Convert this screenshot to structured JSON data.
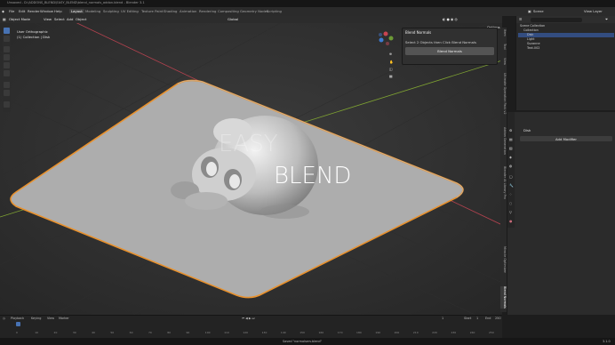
{
  "titlebar": {
    "text": "Unsaved - D:\\ADDONS_BLEND\\EASY_BLEND\\blend_normals_addon.blend - Blender 3.1"
  },
  "menubar": {
    "items": [
      "File",
      "Edit",
      "Render",
      "Window",
      "Help"
    ],
    "workspaces": [
      "Layout",
      "Modeling",
      "Sculpting",
      "UV Editing",
      "Texture Paint",
      "Shading",
      "Animation",
      "Rendering",
      "Compositing",
      "Geometry Nodes",
      "Scripting"
    ],
    "active_workspace": "Layout",
    "scene": "Scene",
    "view_layer": "View Layer"
  },
  "viewport_header": {
    "mode": "Object Mode",
    "menus": [
      "View",
      "Select",
      "Add",
      "Object"
    ],
    "transform": "Global",
    "options": "Options"
  },
  "overlay": {
    "view_name": "User Orthographic",
    "collection": "(1) Collection | Disk"
  },
  "scene_text": {
    "word1": "EASY",
    "word2": "BLEND"
  },
  "panel": {
    "title": "Blend Normals",
    "instruction": "Select 2 Objects then Click Blend Normals",
    "button": "Blend Normals"
  },
  "ntabs": [
    "Item",
    "Tool",
    "View",
    "Ultimate Operation Pack v2",
    "Addon Generation",
    "Blender AI Library Pro",
    "Miracle Optimizer",
    "Blend Normals"
  ],
  "outliner": {
    "search_placeholder": "",
    "items": [
      {
        "label": "Scene Collection",
        "indent": 0,
        "selected": false
      },
      {
        "label": "Collection",
        "indent": 1,
        "selected": false
      },
      {
        "label": "Disk",
        "indent": 2,
        "selected": true
      },
      {
        "label": "Light",
        "indent": 2,
        "selected": false
      },
      {
        "label": "Suzanne",
        "indent": 2,
        "selected": false
      },
      {
        "label": "Text.002",
        "indent": 2,
        "selected": false
      }
    ]
  },
  "properties": {
    "object_name": "Disk",
    "add_modifier": "Add Modifier"
  },
  "timeline": {
    "menus": [
      "Playback",
      "Keying",
      "View",
      "Marker"
    ],
    "current_frame": "1",
    "start_label": "Start",
    "start": "1",
    "end_label": "End",
    "end": "250",
    "ticks": [
      "0",
      "10",
      "20",
      "30",
      "40",
      "50",
      "60",
      "70",
      "80",
      "90",
      "100",
      "110",
      "120",
      "130",
      "140",
      "150",
      "160",
      "170",
      "180",
      "190",
      "200",
      "210",
      "220",
      "230",
      "240",
      "250"
    ]
  },
  "status": {
    "message": "Saved \"normalserv.blend\"",
    "version": "3.1.0"
  },
  "colors": {
    "accent": "#4772b3",
    "selection_outline": "#e8912d",
    "x_axis": "#b5424f",
    "y_axis": "#7fa332"
  }
}
